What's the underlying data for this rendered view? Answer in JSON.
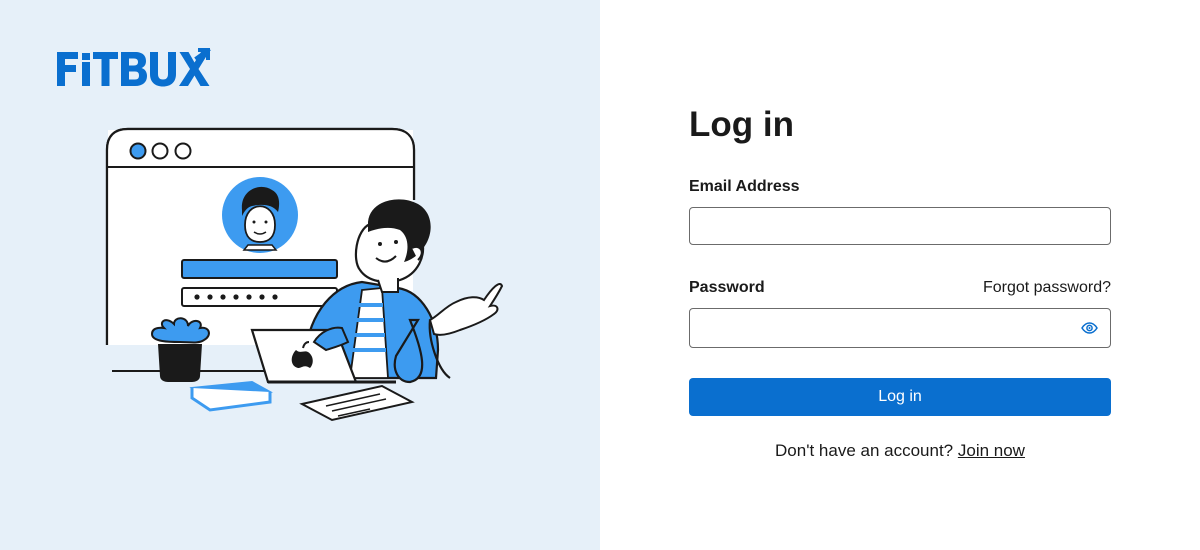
{
  "brand": {
    "logo_text": "FiTBUX",
    "accent_color": "#0a6fcf",
    "logo_icon": "arrow-up-right-icon"
  },
  "illustration": {
    "description_icon": "login-illustration"
  },
  "login": {
    "heading": "Log in",
    "email_label": "Email Address",
    "email_value": "",
    "password_label": "Password",
    "password_value": "",
    "forgot_password": "Forgot password?",
    "show_password_icon": "eye-icon",
    "submit_label": "Log in",
    "signup_prompt": "Don't have an account?",
    "signup_link": "Join now"
  },
  "colors": {
    "left_panel_bg": "#e6f0f9",
    "button_bg": "#0a6fcf",
    "illustration_blue": "#3d9bf0"
  }
}
